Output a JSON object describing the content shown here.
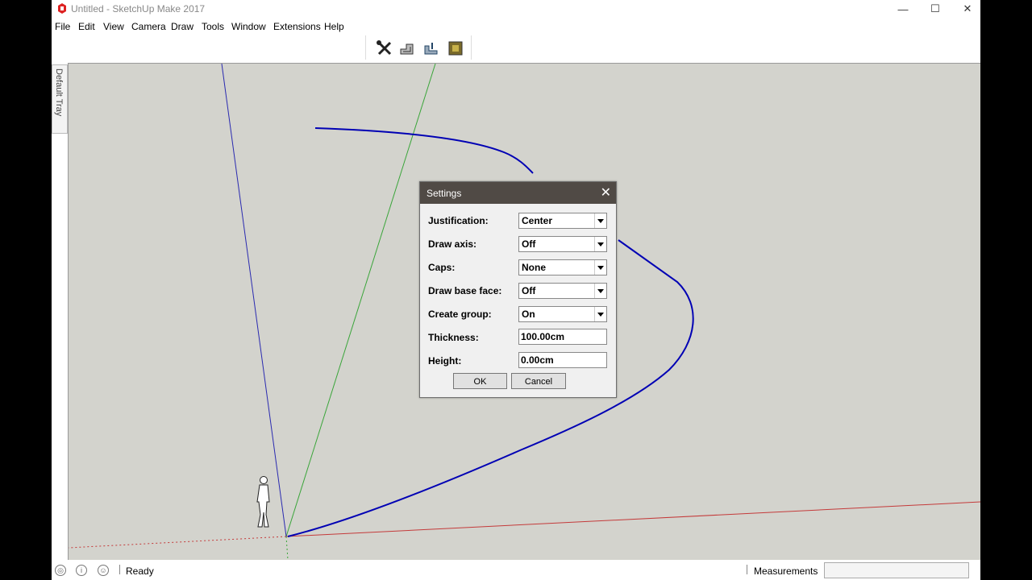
{
  "app": {
    "title": "Untitled - SketchUp Make 2017",
    "menu": [
      "File",
      "Edit",
      "View",
      "Camera",
      "Draw",
      "Tools",
      "Window",
      "Extensions",
      "Help"
    ],
    "toolbar_icons": [
      "wrench-screwdriver-icon",
      "wall-tool-icon",
      "wall-tool-alt-icon",
      "picture-frame-icon"
    ],
    "window_controls": {
      "minimize": "—",
      "maximize": "☐",
      "close": "✕"
    }
  },
  "tray": {
    "label": "Default Tray"
  },
  "status": {
    "text": "Ready",
    "measurements_label": "Measurements",
    "measurements_value": ""
  },
  "dialog": {
    "title": "Settings",
    "close": "✕",
    "fields": [
      {
        "label": "Justification:",
        "value": "Center",
        "type": "select"
      },
      {
        "label": "Draw axis:",
        "value": "Off",
        "type": "select"
      },
      {
        "label": "Caps:",
        "value": "None",
        "type": "select"
      },
      {
        "label": "Draw base face:",
        "value": "Off",
        "type": "select"
      },
      {
        "label": "Create group:",
        "value": "On",
        "type": "select"
      },
      {
        "label": "Thickness:",
        "value": "100.00cm",
        "type": "text"
      },
      {
        "label": "Height:",
        "value": "0.00cm",
        "type": "text"
      }
    ],
    "ok": "OK",
    "cancel": "Cancel"
  },
  "colors": {
    "canvas": "#d3d3cd",
    "curve": "#0000b4",
    "axis_red": "#c43a3a",
    "axis_green": "#3aa53a",
    "axis_blue": "#2a2ab0",
    "dialog_title": "#504a45"
  }
}
